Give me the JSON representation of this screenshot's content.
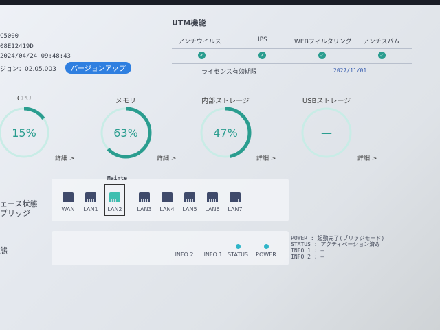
{
  "device": {
    "model": "C5000",
    "serial": "08E12419D",
    "datetime": "2024/04/24 09:48:43",
    "version_label": "ジョン：02.05.003",
    "version_up_button": "バージョンアップ"
  },
  "utm": {
    "title": "UTM機能",
    "columns": [
      "アンチウイルス",
      "IPS",
      "WEBフィルタリング",
      "アンチスパム"
    ],
    "license_label": "ライセンス有効期限",
    "license_date": "2027/11/01",
    "check_icon": "check-circle-icon"
  },
  "gauges": [
    {
      "label": "CPU",
      "value_text": "15%",
      "percent": 15,
      "detail": "詳細 >"
    },
    {
      "label": "メモリ",
      "value_text": "63%",
      "percent": 63,
      "detail": "詳細 >"
    },
    {
      "label": "内部ストレージ",
      "value_text": "47%",
      "percent": 47,
      "detail": "詳細 >"
    },
    {
      "label": "USBストレージ",
      "value_text": "—",
      "percent": 0,
      "detail": "詳細 >"
    }
  ],
  "interfaces": {
    "label_line1": "ェース状態",
    "label_line2": "ブリッジ",
    "mainte_label": "Mainte",
    "ports": [
      "WAN",
      "LAN1",
      "LAN2",
      "LAN3",
      "LAN4",
      "LAN5",
      "LAN6",
      "LAN7"
    ],
    "active_port": "LAN2",
    "colors": {
      "active": "#3fbfb0",
      "inactive": "#3f4a6a"
    }
  },
  "status": {
    "label": "態",
    "leds": [
      {
        "name": "INFO 2",
        "on": false
      },
      {
        "name": "INFO 1",
        "on": false
      },
      {
        "name": "STATUS",
        "on": true
      },
      {
        "name": "POWER",
        "on": true
      }
    ],
    "lines": [
      "POWER  : 起動完了(ブリッジモード)",
      "STATUS : アクティベーション済み",
      "INFO 1 : —",
      "INFO 2 : —"
    ]
  },
  "colors": {
    "accent": "#2a9d8f",
    "button": "#2f7fe0",
    "led_on": "#2fb5c8"
  }
}
